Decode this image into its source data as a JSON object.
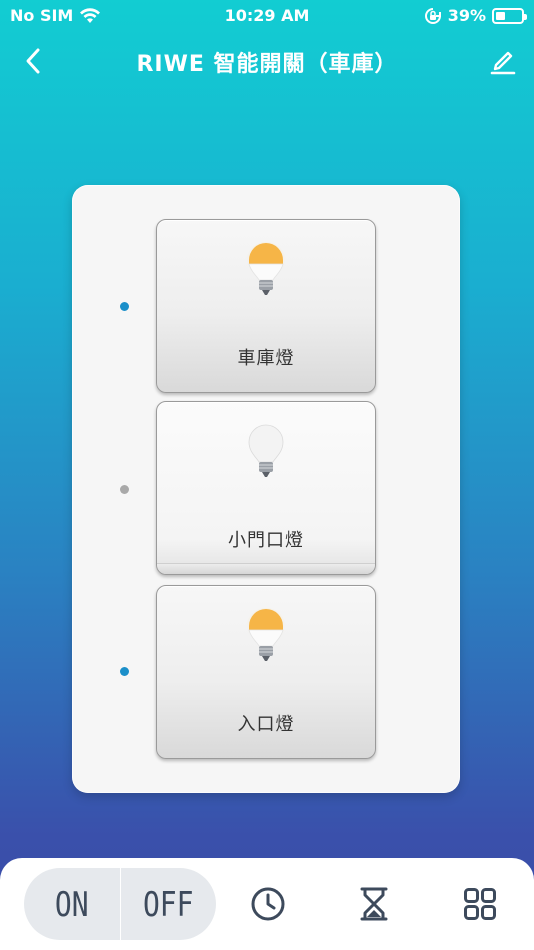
{
  "status_bar": {
    "carrier": "No SIM",
    "time": "10:29 AM",
    "battery_percent": "39%",
    "battery_level": 0.39
  },
  "header": {
    "title": "RIWE 智能開關（車庫）"
  },
  "switches": [
    {
      "label": "車庫燈",
      "state": "on",
      "indicator_color": "#1b8fc9"
    },
    {
      "label": "小門口燈",
      "state": "off",
      "indicator_color": "#a9a9a9"
    },
    {
      "label": "入口燈",
      "state": "on",
      "indicator_color": "#1b8fc9"
    }
  ],
  "bottom_bar": {
    "on_label": "ON",
    "off_label": "OFF",
    "icons": [
      "clock-icon",
      "hourglass-icon",
      "grid-icon"
    ]
  },
  "colors": {
    "accent_text": "#3d4a5c",
    "bulb_on": "#f6b547",
    "bulb_off": "#f2f2f2"
  }
}
